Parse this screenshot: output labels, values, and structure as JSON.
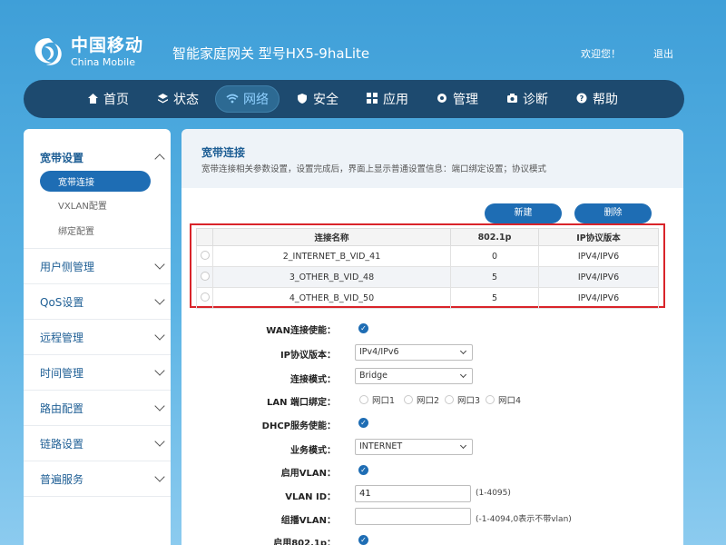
{
  "header": {
    "logo_cn": "中国移动",
    "logo_en": "China Mobile",
    "product": "智能家庭网关 型号HX5-9haLite",
    "welcome": "欢迎您！",
    "logout": "退出"
  },
  "nav": [
    {
      "label": "首页",
      "icon": "home-icon"
    },
    {
      "label": "状态",
      "icon": "layers-icon"
    },
    {
      "label": "网络",
      "icon": "wifi-icon",
      "active": true
    },
    {
      "label": "安全",
      "icon": "shield-icon"
    },
    {
      "label": "应用",
      "icon": "grid-icon"
    },
    {
      "label": "管理",
      "icon": "gear-icon"
    },
    {
      "label": "诊断",
      "icon": "camera-icon"
    },
    {
      "label": "帮助",
      "icon": "help-icon"
    }
  ],
  "sidebar": {
    "open_group": "宽带设置",
    "subitems": [
      "宽带连接",
      "VXLAN配置",
      "绑定配置"
    ],
    "groups": [
      "用户侧管理",
      "QoS设置",
      "远程管理",
      "时间管理",
      "路由配置",
      "链路设置",
      "普遍服务"
    ]
  },
  "main": {
    "title": "宽带连接",
    "desc": "宽带连接相关参数设置，设置完成后，界面上显示普通设置信息：端口绑定设置；协议模式",
    "new_btn": "新建",
    "delete_btn": "删除",
    "table": {
      "headers": [
        "连接名称",
        "802.1p",
        "IP协议版本"
      ],
      "rows": [
        [
          "2_INTERNET_B_VID_41",
          "0",
          "IPV4/IPV6"
        ],
        [
          "3_OTHER_B_VID_48",
          "5",
          "IPV4/IPV6"
        ],
        [
          "4_OTHER_B_VID_50",
          "5",
          "IPV4/IPV6"
        ]
      ]
    },
    "form": {
      "wan_enable_label": "WAN连接使能：",
      "ip_version_label": "IP协议版本：",
      "ip_version_value": "IPv4/IPv6",
      "conn_mode_label": "连接模式：",
      "conn_mode_value": "Bridge",
      "lan_bind_label": "LAN 端口绑定：",
      "lan_ports": [
        "网口1",
        "网口2",
        "网口3",
        "网口4"
      ],
      "dhcp_label": "DHCP服务使能：",
      "service_mode_label": "业务模式：",
      "service_mode_value": "INTERNET",
      "vlan_enable_label": "启用VLAN：",
      "vlan_id_label": "VLAN ID：",
      "vlan_id_value": "41",
      "vlan_id_hint": "(1-4095)",
      "multicast_vlan_label": "组播VLAN：",
      "multicast_vlan_value": "",
      "multicast_vlan_hint": "(-1-4094,0表示不带vlan)",
      "p8021_enable_label": "启用802.1p："
    }
  },
  "colors": {
    "accent": "#1e6db4",
    "nav_bg": "#1d4a6f",
    "highlight_border": "#d9242a"
  }
}
